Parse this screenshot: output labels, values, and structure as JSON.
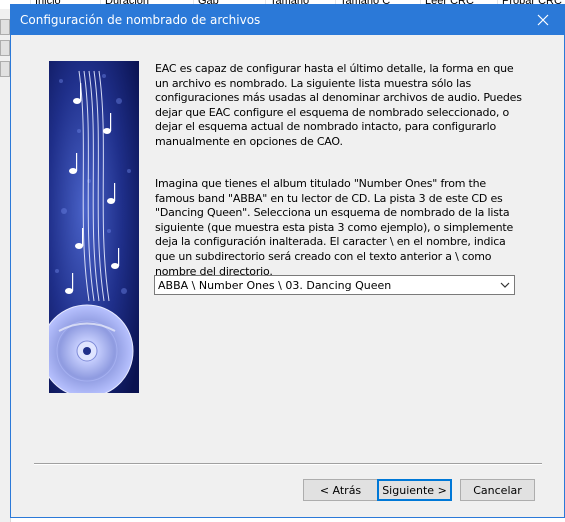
{
  "background_app": {
    "columns": [
      "Inicio",
      "Duración",
      "Gap",
      "Tamaño",
      "Tamaño C",
      "Leer CRC",
      "Probar CRC"
    ]
  },
  "dialog": {
    "title": "Configuración de nombrado de archivos",
    "intro_text": "EAC es capaz de configurar hasta el último detalle, la forma en que un archivo es nombrado. La siguiente lista muestra sólo las configuraciones más usadas al denominar archivos de audio. Puedes dejar que EAC configure el esquema de nombrado seleccionado, o dejar el esquema actual de nombrado intacto, para configurarlo manualmente en opciones de CAO.",
    "example_text": "Imagina que tienes el album titulado \"Number Ones\" from the famous band \"ABBA\" en tu lector de CD. La pista 3 de este CD es  \"Dancing Queen\". Selecciona un esquema de nombrado de la lista siguiente (que muestra esta pista 3 como ejemplo), o simplemente deja la configuración inalterada. El caracter \\ en el nombre, indica que un subdirectorio será creado con el texto anterior a \\ como nombre del directorio.",
    "scheme_select": {
      "selected": "ABBA \\ Number Ones \\ 03. Dancing Queen"
    },
    "buttons": {
      "back": "< Atrás",
      "next": "Siguiente >",
      "cancel": "Cancelar"
    }
  },
  "colors": {
    "titlebar": "#2b79d8",
    "dialog_bg": "#f0f0f0",
    "focus_border": "#0078d7"
  },
  "icons": {
    "close": "close-icon",
    "dropdown": "chevron-down-icon",
    "illustration": "music-cd-illustration"
  }
}
